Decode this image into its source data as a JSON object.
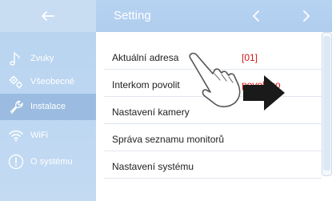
{
  "header": {
    "title": "Setting",
    "back_icon": "back-arrow-icon",
    "prev_icon": "chevron-left-icon",
    "next_icon": "chevron-right-icon"
  },
  "sidebar": {
    "items": [
      {
        "label": "Zvuky",
        "icon": "music-note-icon"
      },
      {
        "label": "Všeobecné",
        "icon": "gears-icon"
      },
      {
        "label": "Instalace",
        "icon": "wrench-icon",
        "active": true
      },
      {
        "label": "WiFi",
        "icon": "wifi-icon"
      },
      {
        "label": "O systému",
        "icon": "info-icon"
      }
    ]
  },
  "settings": {
    "rows": [
      {
        "label": "Aktuální adresa",
        "value": "[01]"
      },
      {
        "label": "Interkom povolit",
        "value": "povoleno"
      },
      {
        "label": "Nastavení kamery",
        "value": ""
      },
      {
        "label": "Správa seznamu monitorů",
        "value": ""
      },
      {
        "label": "Nastavení systému",
        "value": ""
      }
    ]
  },
  "overlay": {
    "icon": "pointing-hand-swipe-icon"
  },
  "colors": {
    "header_blue": "#b5d1f1",
    "sidebar_blue": "#bcd6f1",
    "active_item": "#9bbce0",
    "value_red": "#d41616"
  }
}
